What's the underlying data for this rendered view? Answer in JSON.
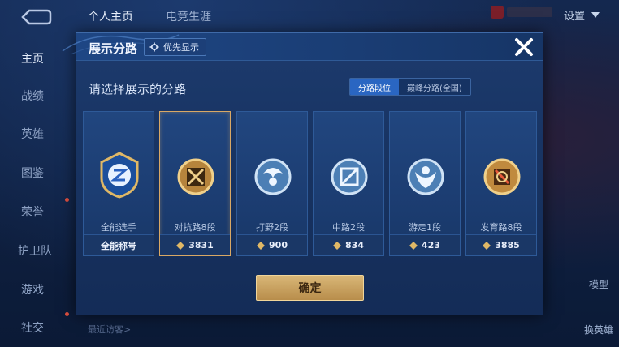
{
  "topnav": {
    "tabs": [
      "个人主页",
      "电竞生涯"
    ]
  },
  "settings": {
    "label": "设置"
  },
  "sidebar": {
    "items": [
      "主页",
      "战绩",
      "英雄",
      "图鉴",
      "荣誉",
      "护卫队",
      "游戏",
      "社交"
    ]
  },
  "right_panel": {
    "model_label": "模型",
    "change_hero_label": "换英雄"
  },
  "footer": {
    "recent_visitors": "最近访客>"
  },
  "modal": {
    "title": "展示分路",
    "priority_label": "优先显示",
    "prompt": "请选择展示的分路",
    "segments": [
      "分路段位",
      "巅峰分路(全国)"
    ],
    "active_segment": 0,
    "confirm_label": "确定",
    "selected_index": 1,
    "cards": [
      {
        "label": "全能选手",
        "stat": "全能称号",
        "tier": "blue"
      },
      {
        "label": "对抗路8段",
        "stat": "3831",
        "tier": "gold"
      },
      {
        "label": "打野2段",
        "stat": "900",
        "tier": "silver"
      },
      {
        "label": "中路2段",
        "stat": "834",
        "tier": "silver"
      },
      {
        "label": "游走1段",
        "stat": "423",
        "tier": "silver"
      },
      {
        "label": "发育路8段",
        "stat": "3885",
        "tier": "gold"
      }
    ]
  },
  "colors": {
    "accent_gold": "#d9b777",
    "accent_blue": "#2a66c2",
    "panel": "#1a3766"
  }
}
